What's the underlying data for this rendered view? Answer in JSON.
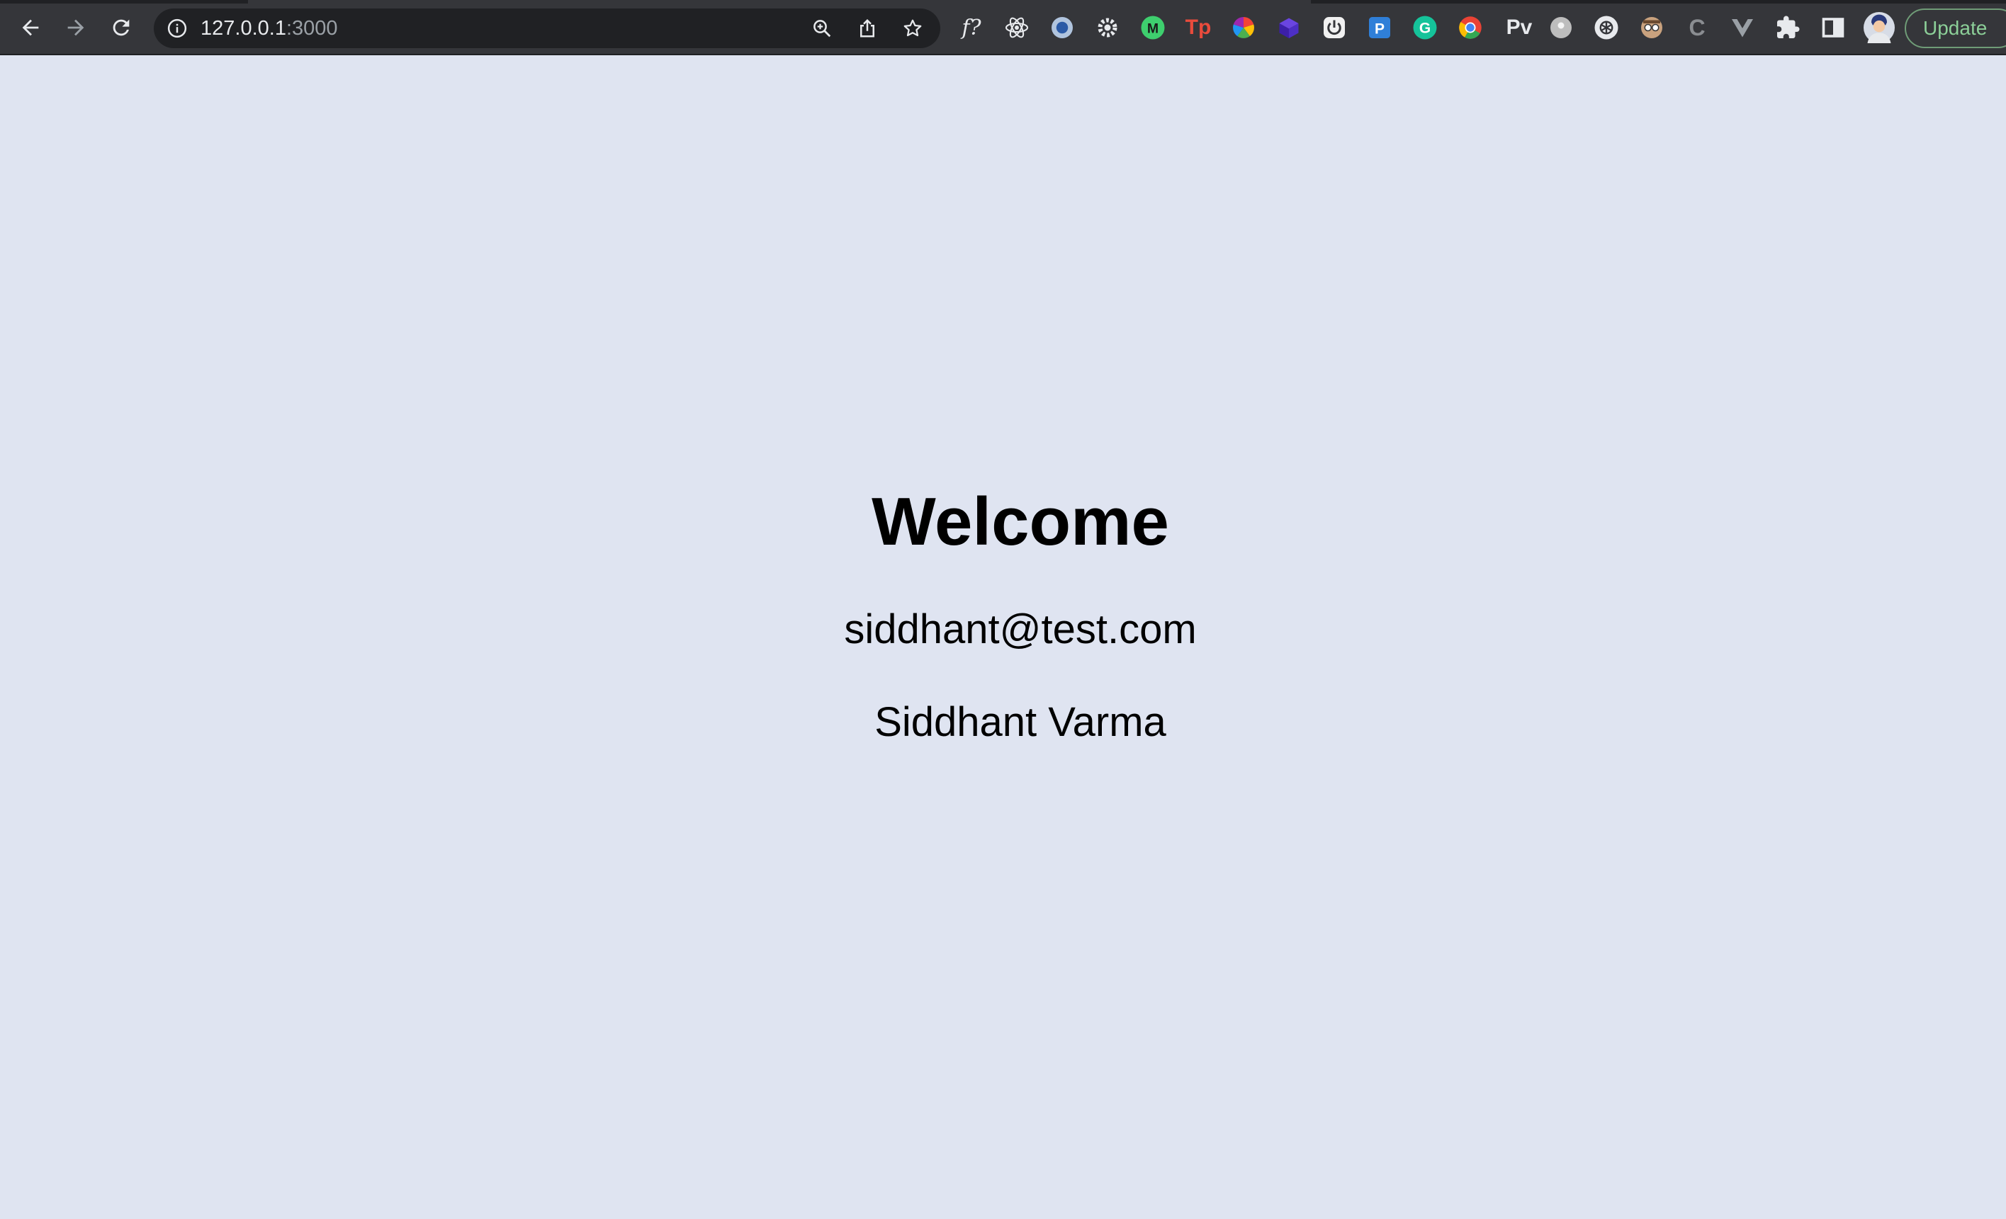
{
  "browser": {
    "url_host": "127.0.0.1",
    "url_port": ":3000",
    "update_label": "Update",
    "extensions": [
      {
        "name": "formula-ext-icon",
        "text": "f?"
      },
      {
        "name": "react-devtools-icon",
        "text": ""
      },
      {
        "name": "blue-circle-ext-icon",
        "text": ""
      },
      {
        "name": "gear-ext-icon",
        "text": ""
      },
      {
        "name": "green-m-ext-icon",
        "text": ""
      },
      {
        "name": "tp-ext-icon",
        "text": "Tp"
      },
      {
        "name": "color-wheel-ext-icon",
        "text": ""
      },
      {
        "name": "purple-cube-ext-icon",
        "text": ""
      },
      {
        "name": "power-ext-icon",
        "text": ""
      },
      {
        "name": "p-ext-icon",
        "text": "P"
      },
      {
        "name": "grammarly-ext-icon",
        "text": "G"
      },
      {
        "name": "chrome-ext-icon",
        "text": ""
      },
      {
        "name": "pv-ext-icon",
        "text": "Pv"
      },
      {
        "name": "grey-dot-ext-icon",
        "text": ""
      },
      {
        "name": "openai-ext-icon",
        "text": ""
      },
      {
        "name": "spy-ext-icon",
        "text": ""
      },
      {
        "name": "c-ext-icon",
        "text": "C"
      },
      {
        "name": "vue-ext-icon",
        "text": ""
      }
    ]
  },
  "page": {
    "title": "Welcome",
    "email": "siddhant@test.com",
    "name": "Siddhant Varma"
  },
  "colors": {
    "page_background": "#dfe4f1",
    "toolbar_background": "#35363a",
    "omnibox_background": "#202124",
    "update_accent": "#8ccf98"
  }
}
